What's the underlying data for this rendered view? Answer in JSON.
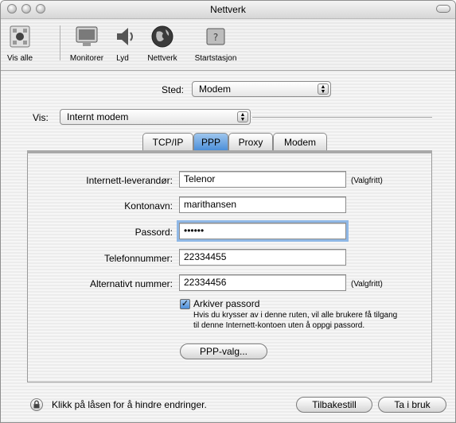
{
  "window": {
    "title": "Nettverk"
  },
  "toolbar": {
    "items": [
      {
        "label": "Vis alle",
        "icon": "apple-grid-icon"
      },
      {
        "label": "Monitorer",
        "icon": "monitor-icon"
      },
      {
        "label": "Lyd",
        "icon": "speaker-icon"
      },
      {
        "label": "Nettverk",
        "icon": "globe-icon"
      },
      {
        "label": "Startstasjon",
        "icon": "disk-icon"
      }
    ]
  },
  "location": {
    "label": "Sted:",
    "value": "Modem"
  },
  "show": {
    "label": "Vis:",
    "value": "Internt modem"
  },
  "tabs": [
    "TCP/IP",
    "PPP",
    "Proxy",
    "Modem"
  ],
  "active_tab": "PPP",
  "form": {
    "provider": {
      "label": "Internett-leverandør:",
      "value": "Telenor",
      "hint": "(Valgfritt)"
    },
    "account": {
      "label": "Kontonavn:",
      "value": "marithansen"
    },
    "password": {
      "label": "Passord:",
      "value": "••••••"
    },
    "phone": {
      "label": "Telefonnummer:",
      "value": "22334455"
    },
    "alt_phone": {
      "label": "Alternativt nummer:",
      "value": "22334456",
      "hint": "(Valgfritt)"
    },
    "save_password": {
      "label": "Arkiver passord",
      "checked": true,
      "note_line1": "Hvis du krysser av i denne ruten, vil alle brukere få tilgang",
      "note_line2": "til denne Internett-kontoen uten å oppgi passord."
    },
    "ppp_options_button": "PPP-valg..."
  },
  "footer": {
    "lock_text": "Klikk på låsen for å hindre endringer.",
    "revert_button": "Tilbakestill",
    "apply_button": "Ta i bruk"
  },
  "colors": {
    "accent": "#4c8fd9",
    "focus": "#90b8e6"
  }
}
